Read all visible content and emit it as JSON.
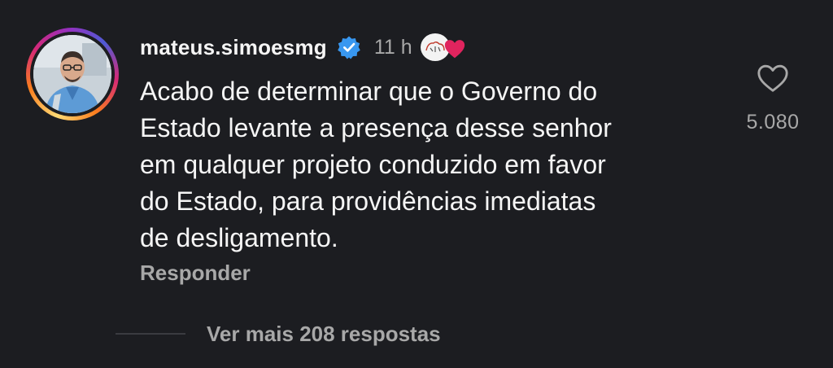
{
  "comment": {
    "username": "mateus.simoesmg",
    "verified_icon": "verified-badge-icon",
    "time": "11 h",
    "author_reaction_icon": "profile-heart-icon",
    "text_lines": [
      "Acabo de determinar que o Governo do",
      "Estado levante a presença desse senhor",
      "em qualquer projeto conduzido em favor",
      "do Estado, para providências imediatas",
      "de desligamento."
    ],
    "reply_label": "Responder",
    "like_icon": "heart-outline-icon",
    "like_count": "5.080",
    "view_more_label": "Ver mais 208 respostas"
  },
  "colors": {
    "background": "#1c1d21",
    "primary_text": "#f5f5f5",
    "secondary_text": "#a8a8a8",
    "verified_blue": "#3897f0",
    "heart_red": "#e0245e"
  }
}
